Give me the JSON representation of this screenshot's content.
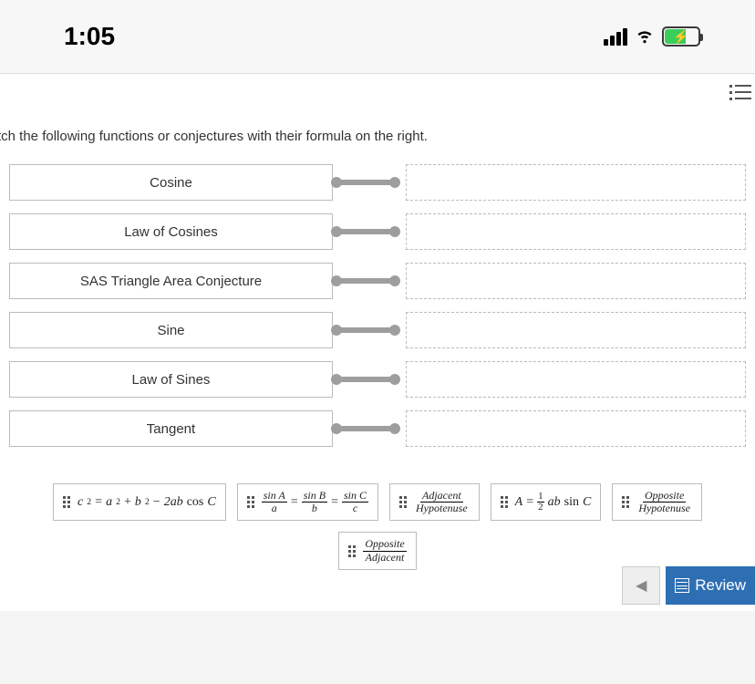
{
  "status_bar": {
    "time": "1:05"
  },
  "instruction_text": "tch the following functions or conjectures with their formula on the right.",
  "terms": [
    "Cosine",
    "Law of Cosines",
    "SAS Triangle Area Conjecture",
    "Sine",
    "Law of Sines",
    "Tangent"
  ],
  "chips": {
    "law_of_cosines": {
      "lhs": "c",
      "rhs_a": "a",
      "rhs_b": "b",
      "rhs_term": "2ab",
      "trig": "cos",
      "angle": "C"
    },
    "law_of_sines": {
      "sinA": "sin A",
      "a": "a",
      "sinB": "sin B",
      "b": "b",
      "sinC": "sin C",
      "c": "c"
    },
    "cosine_def": {
      "num": "Adjacent",
      "den": "Hypotenuse"
    },
    "sas": {
      "A": "A",
      "half_n": "1",
      "half_d": "2",
      "ab": "ab",
      "trig": "sin",
      "angle": "C"
    },
    "sine_def": {
      "num": "Opposite",
      "den": "Hypotenuse"
    },
    "tangent_def": {
      "num": "Opposite",
      "den": "Adjacent"
    }
  },
  "footer": {
    "review_label": "Review"
  }
}
